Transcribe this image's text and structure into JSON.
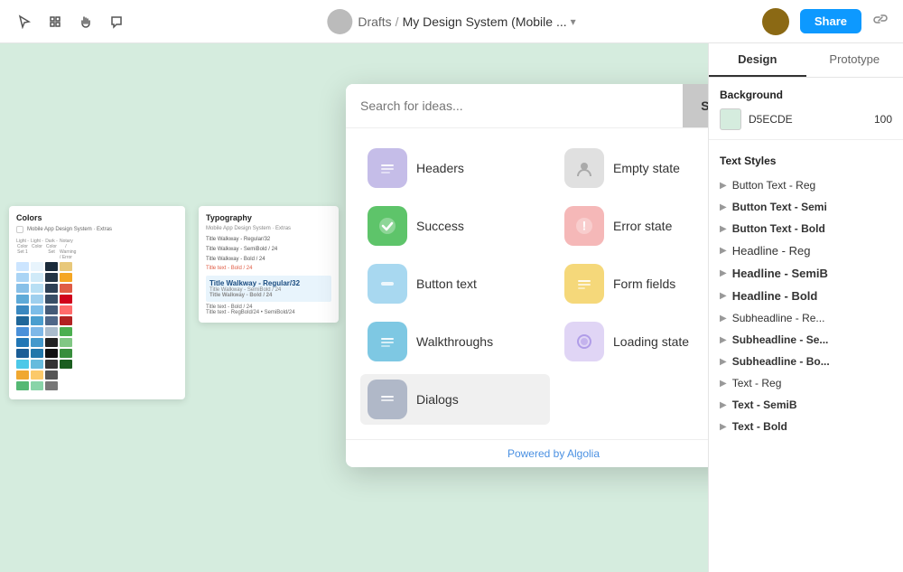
{
  "topbar": {
    "drafts_label": "Drafts",
    "separator": "/",
    "file_name": "My Design System (Mobile ...",
    "share_label": "Share"
  },
  "picker": {
    "search_placeholder": "Search for ideas...",
    "search_button": "Search",
    "items": [
      {
        "id": "headers",
        "label": "Headers",
        "icon": "☰",
        "color": "ic-purple"
      },
      {
        "id": "empty-state",
        "label": "Empty state",
        "icon": "👤",
        "color": "ic-gray-light"
      },
      {
        "id": "success",
        "label": "Success",
        "icon": "✔",
        "color": "ic-green"
      },
      {
        "id": "error-state",
        "label": "Error state",
        "icon": "!",
        "color": "ic-pink"
      },
      {
        "id": "button-text",
        "label": "Button text",
        "icon": "—",
        "color": "ic-blue-light"
      },
      {
        "id": "form-fields",
        "label": "Form fields",
        "icon": "☰",
        "color": "ic-yellow"
      },
      {
        "id": "walkthroughs",
        "label": "Walkthroughs",
        "icon": "☰",
        "color": "ic-blue"
      },
      {
        "id": "loading-state",
        "label": "Loading state",
        "icon": "◎",
        "color": "ic-purple-light"
      },
      {
        "id": "dialogs",
        "label": "Dialogs",
        "icon": "☰",
        "color": "ic-gray"
      }
    ],
    "footer": "Powered by Algolia"
  },
  "right_panel": {
    "tab_design": "Design",
    "tab_prototype": "Prototype",
    "background_label": "Background",
    "bg_hex": "D5ECDE",
    "bg_opacity": "100",
    "text_styles_label": "Text Styles",
    "text_styles": [
      {
        "label": "Button Text - Reg"
      },
      {
        "label": "Button Text - Semi"
      },
      {
        "label": "Button Text - Bold"
      },
      {
        "label": "Headline - Reg"
      },
      {
        "label": "Headline - SemiB"
      },
      {
        "label": "Headline - Bold"
      },
      {
        "label": "Subheadline - Re..."
      },
      {
        "label": "Subheadline - Se..."
      },
      {
        "label": "Subheadline - Bo..."
      },
      {
        "label": "Text - Reg"
      },
      {
        "label": "Text - SemiB"
      },
      {
        "label": "Text - Bold"
      }
    ]
  },
  "canvas_cards": {
    "colors_title": "Colors",
    "typo_title": "Typography"
  },
  "icons": {
    "cursor": "↖",
    "move": "✥",
    "comment": "💬",
    "link": "🔗"
  }
}
